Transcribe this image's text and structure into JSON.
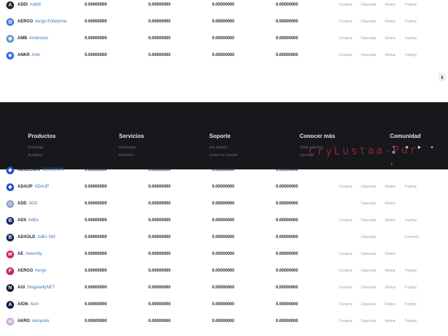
{
  "top_rows": [
    {
      "symbol": "ADDI",
      "name": "Adddi",
      "v1": "0.00000000",
      "v2": "0.00000000",
      "v3": "0.00000000",
      "v4": "0.00000000",
      "a1": "Comprar",
      "a2": "Depositar",
      "a3": "Retirar",
      "a4": "Trading",
      "icon_color": "#1e2329",
      "icon_glyph": "A"
    },
    {
      "symbol": "AERGO",
      "name": "Aergo Enterprise",
      "v1": "0.00000000",
      "v2": "0.00000000",
      "v3": "0.00000000",
      "v4": "0.00000000",
      "a1": "Comprar",
      "a2": "Depositar",
      "a3": "Retirar",
      "a4": "Trading",
      "icon_color": "#3d7fd9",
      "icon_glyph": "◎"
    },
    {
      "symbol": "AMB",
      "name": "Ambrosus",
      "v1": "0.00000000",
      "v2": "0.00000000",
      "v3": "0.00000000",
      "v4": "0.00000000",
      "a1": "Comprar",
      "a2": "Depositar",
      "a3": "Retirar",
      "a4": "Trading",
      "icon_color": "#5c8fd6",
      "icon_glyph": "◉"
    },
    {
      "symbol": "ANKR",
      "name": "Ankr",
      "v1": "0.00000000",
      "v2": "0.00000000",
      "v3": "0.00000000",
      "v4": "0.00000000",
      "a1": "Comprar",
      "a2": "Depositar",
      "a3": "Retirar",
      "a4": "Trading",
      "icon_color": "#2e6fd8",
      "icon_glyph": "◈"
    }
  ],
  "bottom_rows": [
    {
      "symbol": "ADADOWN",
      "name": "ADADOWN",
      "v1": "0.00000000",
      "v2": "0.00000000",
      "v3": "0.00000000",
      "v4": "0.00000000",
      "a1": "",
      "a2": "",
      "a3": "",
      "a4": "",
      "icon_color": "#2a4dbd",
      "icon_glyph": "◆"
    },
    {
      "symbol": "ADAUP",
      "name": "ADAUP",
      "v1": "0.00000000",
      "v2": "0.00000000",
      "v3": "0.00000000",
      "v4": "0.00000000",
      "a1": "Comprar",
      "a2": "Depositar",
      "a3": "Retirar",
      "a4": "Trading",
      "icon_color": "#2a4dbd",
      "icon_glyph": "◆"
    },
    {
      "symbol": "ADD",
      "name": "ADD",
      "v1": "0.00000000",
      "v2": "0.00000000",
      "v3": "0.00000000",
      "v4": "0.00000000",
      "a1": "",
      "a2": "Depositar",
      "a3": "Retirar",
      "a4": "",
      "icon_color": "#8da4c9",
      "icon_glyph": "◇"
    },
    {
      "symbol": "ADX",
      "name": "AdEx",
      "v1": "0.00000000",
      "v2": "0.00000000",
      "v3": "0.00000000",
      "v4": "0.00000000",
      "a1": "Comprar",
      "a2": "Depositar",
      "a3": "Retirar",
      "a4": "Trading",
      "icon_color": "#1b2a5c",
      "icon_glyph": "B"
    },
    {
      "symbol": "ADXOLD",
      "name": "AdEx Old",
      "v1": "0.00000000",
      "v2": "0.00000000",
      "v3": "0.00000000",
      "v4": "0.00000000",
      "a1": "",
      "a2": "Depositar",
      "a3": "",
      "a4": "Convertir",
      "icon_color": "#1b2a5c",
      "icon_glyph": "B"
    },
    {
      "symbol": "AE",
      "name": "Aeternity",
      "v1": "0.00000000",
      "v2": "0.00000000",
      "v3": "0.00000000",
      "v4": "0.00000000",
      "a1": "Comprar",
      "a2": "Depositar",
      "a3": "Retirar",
      "a4": "",
      "icon_color": "#d6245c",
      "icon_glyph": "æ"
    },
    {
      "symbol": "AERGO",
      "name": "Aergo",
      "v1": "0.00000000",
      "v2": "0.00000000",
      "v3": "0.00000000",
      "v4": "0.00000000",
      "a1": "Comprar",
      "a2": "Depositar",
      "a3": "Retirar",
      "a4": "Trading",
      "icon_color": "#c0236a",
      "icon_glyph": "P"
    },
    {
      "symbol": "AGI",
      "name": "SingularityNET",
      "v1": "0.00000000",
      "v2": "0.00000000",
      "v3": "0.00000000",
      "v4": "0.00000000",
      "a1": "Comprar",
      "a2": "Depositar",
      "a3": "Retirar",
      "a4": "Trading",
      "icon_color": "#161a33",
      "icon_glyph": "N"
    },
    {
      "symbol": "AION",
      "name": "Aion",
      "v1": "0.00000000",
      "v2": "0.00000000",
      "v3": "0.00000000",
      "v4": "0.00000000",
      "a1": "Comprar",
      "a2": "Depositar",
      "a3": "Retirar",
      "a4": "Trading",
      "icon_color": "#0f1e45",
      "icon_glyph": "A"
    },
    {
      "symbol": "AKRO",
      "name": "Akropolis",
      "v1": "0.00000000",
      "v2": "0.00000000",
      "v3": "0.00000000",
      "v4": "0.00000000",
      "a1": "Comprar",
      "a2": "Depositar",
      "a3": "Retirar",
      "a4": "Trading",
      "icon_color": "#c6a9d6",
      "icon_glyph": "◎"
    }
  ],
  "footer": {
    "productos": {
      "title": "Productos",
      "links": [
        "Exchange",
        "Academy"
      ]
    },
    "servicios": {
      "title": "Servicios",
      "links": [
        "Descargas",
        "Escritorio"
      ]
    },
    "soporte": {
      "title": "Soporte",
      "links": [
        "Dar opinión",
        "Centro de soporte"
      ]
    },
    "conocer": {
      "title": "Conocer más",
      "links": [
        "Sobre nosotros",
        "Carreras"
      ]
    },
    "comunidad": {
      "title": "Comunidad"
    }
  },
  "social_icons": "✈ ◆ ▶ ● ◉",
  "social_icons_2": "♪",
  "watermark": "CryLustaa-Pur",
  "scroll_glyph": "⬍"
}
